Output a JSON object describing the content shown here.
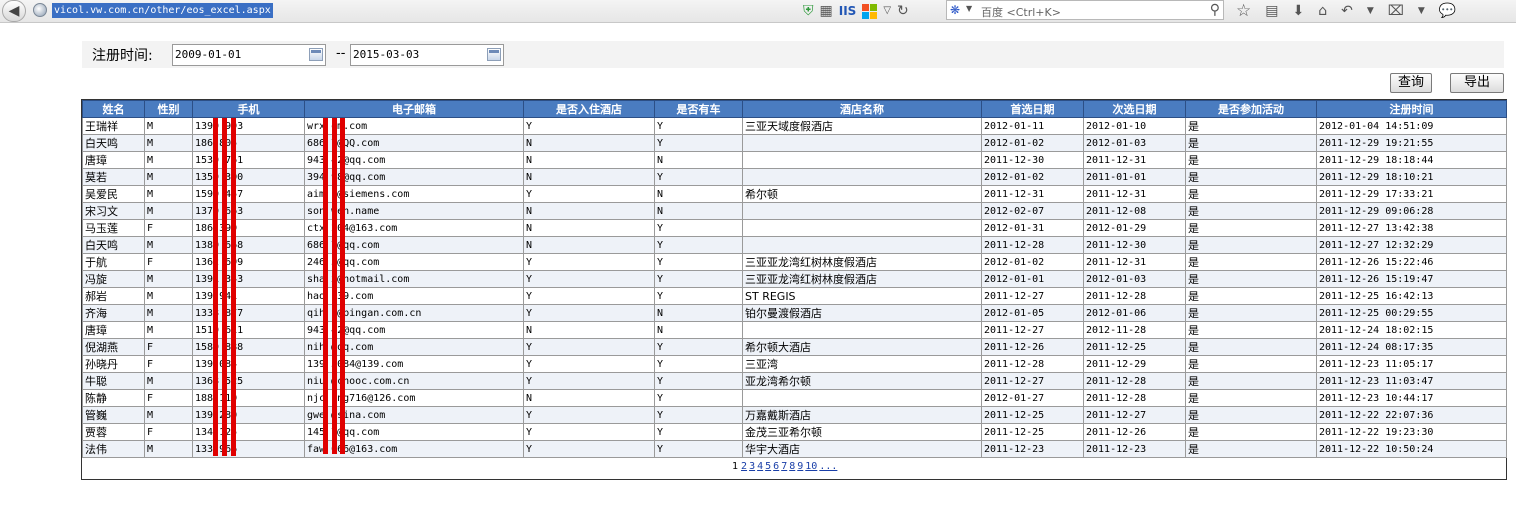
{
  "browser": {
    "url": "vicol.vw.com.cn/other/eos_excel.aspx",
    "iis_label": "IIS",
    "search_placeholder": "百度 <Ctrl+K>"
  },
  "filter": {
    "label": "注册时间:",
    "start_date": "2009-01-01",
    "separator": "--",
    "end_date": "2015-03-03"
  },
  "buttons": {
    "query": "查询",
    "export": "导出"
  },
  "table": {
    "columns": [
      "姓名",
      "性别",
      "手机",
      "电子邮箱",
      "是否入住酒店",
      "是否有车",
      "酒店名称",
      "首选日期",
      "次选日期",
      "是否参加活动",
      "注册时间"
    ],
    "rows": [
      [
        "王瑞祥",
        "M",
        "1390  993",
        "wrx  om.com",
        "Y",
        "Y",
        "三亚天域度假酒店",
        "2012-01-11",
        "2012-01-10",
        "是",
        "2012-01-04 14:51:09"
      ],
      [
        "白天鸣",
        "M",
        "186  805",
        "686  7@QQ.com",
        "N",
        "Y",
        "",
        "2012-01-02",
        "2012-01-03",
        "是",
        "2011-12-29 19:21:55"
      ],
      [
        "唐璋",
        "M",
        "1530  761",
        "943  42@qq.com",
        "N",
        "N",
        "",
        "2011-12-30",
        "2011-12-31",
        "是",
        "2011-12-29 18:18:44"
      ],
      [
        "莫若",
        "M",
        "1359  300",
        "394  98@qq.com",
        "N",
        "Y",
        "",
        "2012-01-02",
        "2011-01-01",
        "是",
        "2011-12-29 18:10:21"
      ],
      [
        "吴爱民",
        "M",
        "1590  457",
        "aim  u@siemens.com",
        "Y",
        "N",
        "希尔顿",
        "2011-12-31",
        "2011-12-31",
        "是",
        "2011-12-29 17:33:21"
      ],
      [
        "宋习文",
        "M",
        "1370  663",
        "son  wen.name",
        "N",
        "N",
        "",
        "2012-02-07",
        "2011-12-08",
        "是",
        "2011-12-29 09:06:28"
      ],
      [
        "马玉莲",
        "F",
        "186  399",
        "ctx  204@163.com",
        "N",
        "Y",
        "",
        "2012-01-31",
        "2012-01-29",
        "是",
        "2011-12-27 13:42:38"
      ],
      [
        "白天鸣",
        "M",
        "1380  668",
        "686  7@qq.com",
        "N",
        "Y",
        "",
        "2011-12-28",
        "2011-12-30",
        "是",
        "2011-12-27 12:32:29"
      ],
      [
        "于航",
        "F",
        "1362  699",
        "246  5@qq.com",
        "Y",
        "Y",
        "三亚亚龙湾红树林度假酒店",
        "2012-01-02",
        "2011-12-31",
        "是",
        "2011-12-26 15:22:46"
      ],
      [
        "冯旋",
        "M",
        "1391  343",
        "sha  x@hotmail.com",
        "Y",
        "Y",
        "三亚亚龙湾红树林度假酒店",
        "2012-01-01",
        "2012-01-03",
        "是",
        "2011-12-26 15:19:47"
      ],
      [
        "郝岩",
        "M",
        "139  941",
        "hao  139.com",
        "Y",
        "Y",
        "ST REGIS",
        "2011-12-27",
        "2011-12-28",
        "是",
        "2011-12-25 16:42:13"
      ],
      [
        "齐海",
        "M",
        "1338  877",
        "qih  1@pingan.com.cn",
        "Y",
        "N",
        "铂尔曼渡假酒店",
        "2012-01-05",
        "2012-01-06",
        "是",
        "2011-12-25 00:29:55"
      ],
      [
        "唐璋",
        "M",
        "1510  611",
        "943  42@qq.com",
        "N",
        "N",
        "",
        "2011-12-27",
        "2012-11-28",
        "是",
        "2011-12-24 18:02:15"
      ],
      [
        "倪湖燕",
        "F",
        "1589  888",
        "nih  @qq.com",
        "Y",
        "Y",
        "希尔顿大酒店",
        "2011-12-26",
        "2011-12-25",
        "是",
        "2011-12-24 08:17:35"
      ],
      [
        "孙晓丹",
        "F",
        "139  084",
        "139  5084@139.com",
        "Y",
        "Y",
        "三亚湾",
        "2011-12-28",
        "2011-12-29",
        "是",
        "2011-12-23 11:05:17"
      ],
      [
        "牛聪",
        "M",
        "1368  525",
        "niu  @cnooc.com.cn",
        "Y",
        "Y",
        "亚龙湾希尔顿",
        "2011-12-27",
        "2011-12-28",
        "是",
        "2011-12-23 11:03:47"
      ],
      [
        "陈静",
        "F",
        "188  110",
        "njc  ing716@126.com",
        "N",
        "Y",
        "",
        "2012-01-27",
        "2011-12-28",
        "是",
        "2011-12-23 10:44:17"
      ],
      [
        "管巍",
        "M",
        "139  280",
        "gwe  @sina.com",
        "Y",
        "Y",
        "万嘉戴斯酒店",
        "2011-12-25",
        "2011-12-27",
        "是",
        "2011-12-22 22:07:36"
      ],
      [
        "贾蓉",
        "F",
        "134  125",
        "145  7@qq.com",
        "Y",
        "Y",
        "金茂三亚希尔顿",
        "2011-12-25",
        "2011-12-26",
        "是",
        "2011-12-22 19:23:30"
      ],
      [
        "法伟",
        "M",
        "133  966",
        "faw  666@163.com",
        "Y",
        "Y",
        "华宇大酒店",
        "2011-12-23",
        "2011-12-23",
        "是",
        "2011-12-22 10:50:24"
      ]
    ]
  },
  "pagination": {
    "current": "1",
    "pages": [
      "2",
      "3",
      "4",
      "5",
      "6",
      "7",
      "8",
      "9",
      "10"
    ],
    "more": "..."
  },
  "colors": {
    "header_bg": "#4a7cc0",
    "redaction": "#e00000",
    "url_highlight": "#3a6fc4"
  }
}
